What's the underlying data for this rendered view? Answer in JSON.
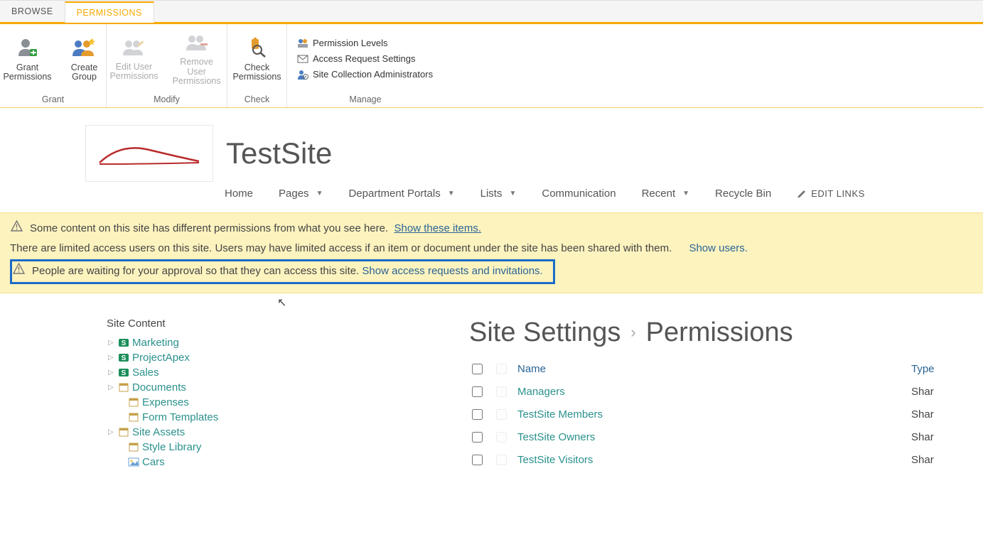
{
  "tabs": {
    "browse": "BROWSE",
    "permissions": "PERMISSIONS"
  },
  "ribbon": {
    "grant": {
      "grant_perm": "Grant\nPermissions",
      "create_group": "Create\nGroup",
      "label": "Grant"
    },
    "modify": {
      "edit_user": "Edit User\nPermissions",
      "remove_user": "Remove User\nPermissions",
      "label": "Modify"
    },
    "check": {
      "check_perm": "Check\nPermissions",
      "label": "Check"
    },
    "manage": {
      "perm_levels": "Permission Levels",
      "access_req": "Access Request Settings",
      "site_admins": "Site Collection Administrators",
      "label": "Manage"
    }
  },
  "header": {
    "title": "TestSite",
    "nav": [
      "Home",
      "Pages",
      "Department Portals",
      "Lists",
      "Communication",
      "Recent",
      "Recycle Bin"
    ],
    "dropdown_idx": [
      1,
      2,
      3,
      5
    ],
    "edit_links": "EDIT LINKS"
  },
  "banner": {
    "line1": "Some content on this site has different permissions from what you see here.",
    "line1_link": "Show these items.",
    "line2": "There are limited access users on this site. Users may have limited access if an item or document under the site has been shared with them.",
    "line2_link": "Show users.",
    "line3": "People are waiting for your approval so that they can access this site.",
    "line3_link": "Show access requests and invitations."
  },
  "tree": {
    "heading": "Site Content",
    "items": [
      {
        "label": "Marketing",
        "exp": true,
        "type": "site"
      },
      {
        "label": "ProjectApex",
        "exp": true,
        "type": "site"
      },
      {
        "label": "Sales",
        "exp": true,
        "type": "site"
      },
      {
        "label": "Documents",
        "exp": true,
        "type": "lib"
      },
      {
        "label": "Expenses",
        "exp": false,
        "type": "lib",
        "indent": true
      },
      {
        "label": "Form Templates",
        "exp": false,
        "type": "lib",
        "indent": true
      },
      {
        "label": "Site Assets",
        "exp": true,
        "type": "lib"
      },
      {
        "label": "Style Library",
        "exp": false,
        "type": "lib",
        "indent": true
      },
      {
        "label": "Cars",
        "exp": false,
        "type": "pic",
        "indent": true
      }
    ]
  },
  "right": {
    "bc1": "Site Settings",
    "bc2": "Permissions",
    "cols": {
      "name": "Name",
      "type": "Type"
    },
    "rows": [
      {
        "name": "Managers",
        "type": "Shar"
      },
      {
        "name": "TestSite Members",
        "type": "Shar"
      },
      {
        "name": "TestSite Owners",
        "type": "Shar"
      },
      {
        "name": "TestSite Visitors",
        "type": "Shar"
      }
    ]
  }
}
